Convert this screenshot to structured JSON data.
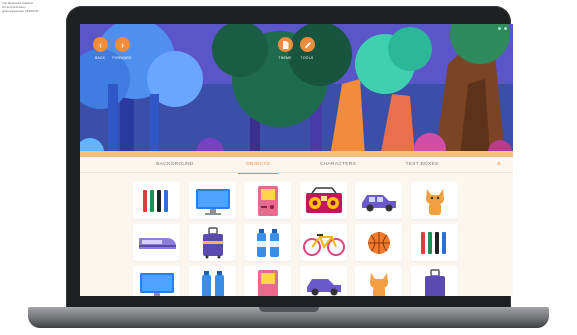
{
  "corner_note": [
    "The Illustrated Jukebox",
    "Art and Animation",
    "grant agreement SPF09-00"
  ],
  "toolbar": {
    "back_label": "BACK",
    "forward_label": "FORWARD",
    "theme_label": "THEME",
    "tools_label": "TOOLS",
    "back_icon": "chevron-left-icon",
    "forward_icon": "chevron-right-icon",
    "theme_icon": "document-icon",
    "tools_icon": "pencil-icon"
  },
  "tabs": [
    {
      "label": "BACKGROUND",
      "active": false
    },
    {
      "label": "OBJECTS",
      "active": true
    },
    {
      "label": "CHARACTERS",
      "active": false
    },
    {
      "label": "TEXT BOXES",
      "active": false
    }
  ],
  "close_label": "×",
  "objects": [
    {
      "name": "markers"
    },
    {
      "name": "monitor"
    },
    {
      "name": "game-console"
    },
    {
      "name": "boombox"
    },
    {
      "name": "car"
    },
    {
      "name": "cat"
    },
    {
      "name": "train"
    },
    {
      "name": "suitcase"
    },
    {
      "name": "water-bottles"
    },
    {
      "name": "bicycle"
    },
    {
      "name": "basketball"
    },
    {
      "name": "markers"
    },
    {
      "name": "monitor"
    },
    {
      "name": "water-bottles"
    },
    {
      "name": "game-console"
    },
    {
      "name": "car"
    },
    {
      "name": "cat"
    },
    {
      "name": "suitcase"
    }
  ],
  "colors": {
    "accent": "#f28b3c",
    "tab_text": "#7d7370",
    "panel_bg": "#fdf6ef"
  }
}
